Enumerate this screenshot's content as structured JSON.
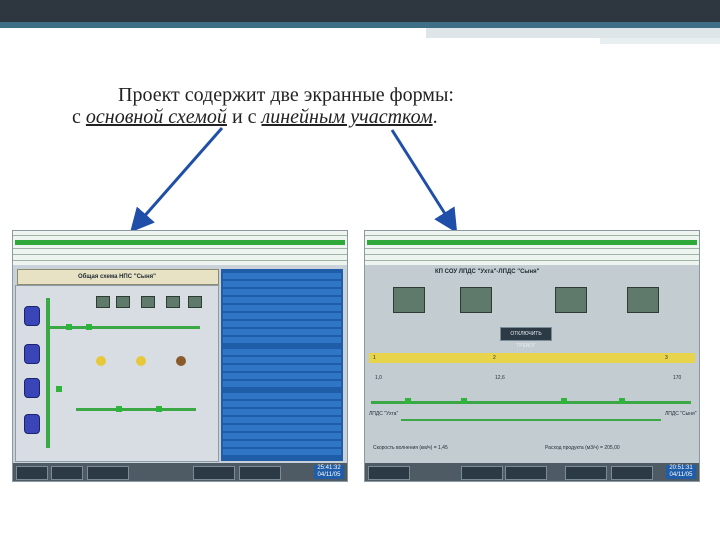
{
  "caption": {
    "line1": "Проект содержит две экранные формы:",
    "line2_prefix": "с ",
    "line2_link1": "основной схемой",
    "line2_mid": " и с ",
    "line2_link2": "линейным участком",
    "line2_suffix": "."
  },
  "left_screen": {
    "title": "Общая схема НПС \"Сыня\"",
    "clock_time": "25:41:32",
    "clock_date": "04/11/05"
  },
  "right_screen": {
    "title": "КП СОУ ЛПДС \"Ухта\"-ЛПДС \"Сыня\"",
    "speed_label": "Скорость волнения (км/ч) = 1,45",
    "flow_label": "Расход продукта (м3/ч) = 205,00",
    "clock_time": "20:51:31",
    "clock_date": "04/11/05",
    "marker1": "1",
    "marker2": "2",
    "marker3": "3",
    "btn_unmask": "ОТКЛЮЧИТЬ ТРЕВОГ",
    "left_station": "ЛПДС \"Ухта\"",
    "right_station": "ЛПДС \"Сыня\"",
    "km_left": "1,0",
    "km_mid": "12,6",
    "km_right": "170"
  },
  "colors": {
    "accent_blue": "#1f5da8",
    "pipe_green": "#3aa845",
    "header_green": "#2faa3a",
    "arrow_blue": "#1f4fa8"
  }
}
